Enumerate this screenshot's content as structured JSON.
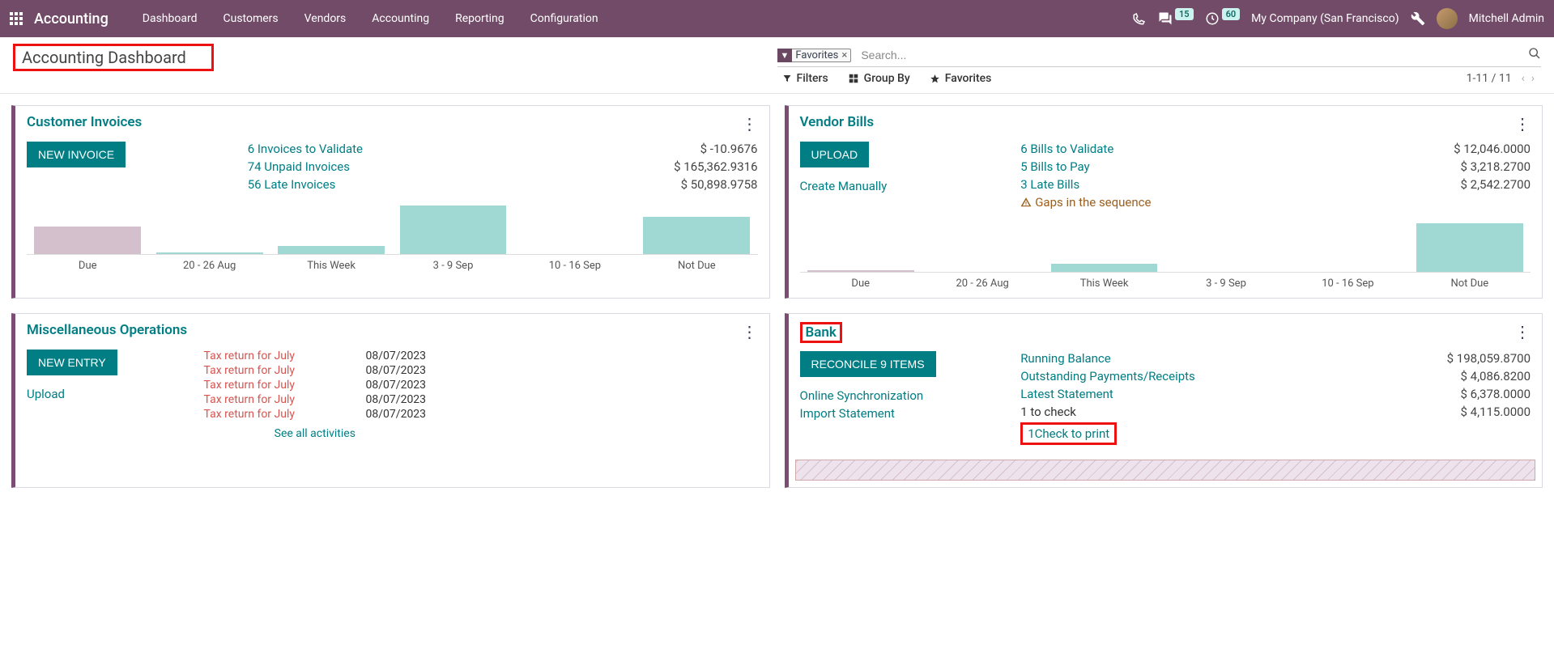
{
  "navbar": {
    "brand": "Accounting",
    "menus": [
      "Dashboard",
      "Customers",
      "Vendors",
      "Accounting",
      "Reporting",
      "Configuration"
    ],
    "msg_count": "15",
    "activity_count": "60",
    "company": "My Company (San Francisco)",
    "username": "Mitchell Admin"
  },
  "breadcrumb": {
    "title": "Accounting Dashboard"
  },
  "search": {
    "active_filter": "Favorites",
    "placeholder": "Search...",
    "tb_filters": "Filters",
    "tb_groupby": "Group By",
    "tb_favorites": "Favorites",
    "pager": "1-11 / 11"
  },
  "chart_data": [
    {
      "type": "bar",
      "title": "Customer Invoices",
      "categories": [
        "Due",
        "20 - 26 Aug",
        "This Week",
        "3 - 9 Sep",
        "10 - 16 Sep",
        "Not Due"
      ],
      "values": [
        -28,
        2,
        8,
        50,
        0,
        38
      ],
      "colors": [
        "neg",
        "pos",
        "pos",
        "pos",
        "pos",
        "pos"
      ]
    },
    {
      "type": "bar",
      "title": "Vendor Bills",
      "categories": [
        "Due",
        "20 - 26 Aug",
        "This Week",
        "3 - 9 Sep",
        "10 - 16 Sep",
        "Not Due"
      ],
      "values": [
        -2,
        0,
        8,
        0,
        0,
        48
      ],
      "colors": [
        "neg",
        "pos",
        "pos",
        "pos",
        "pos",
        "pos"
      ]
    }
  ],
  "cards": {
    "cust_inv": {
      "title": "Customer Invoices",
      "button": "NEW INVOICE",
      "links": [
        "6 Invoices to Validate",
        "74 Unpaid Invoices",
        "56 Late Invoices"
      ],
      "amounts": [
        "$ -10.9676",
        "$ 165,362.9316",
        "$ 50,898.9758"
      ]
    },
    "vendor_bills": {
      "title": "Vendor Bills",
      "button": "UPLOAD",
      "create": "Create Manually",
      "links": [
        "6 Bills to Validate",
        "5 Bills to Pay",
        "3 Late Bills"
      ],
      "amounts": [
        "$ 12,046.0000",
        "$ 3,218.2700",
        "$ 2,542.2700"
      ],
      "warning": "Gaps in the sequence"
    },
    "misc": {
      "title": "Miscellaneous Operations",
      "button": "NEW ENTRY",
      "upload": "Upload",
      "rows": [
        {
          "label": "Tax return for July",
          "date": "08/07/2023"
        },
        {
          "label": "Tax return for July",
          "date": "08/07/2023"
        },
        {
          "label": "Tax return for July",
          "date": "08/07/2023"
        },
        {
          "label": "Tax return for July",
          "date": "08/07/2023"
        },
        {
          "label": "Tax return for July",
          "date": "08/07/2023"
        }
      ],
      "see_all": "See all activities"
    },
    "bank": {
      "title": "Bank",
      "button": "RECONCILE 9 ITEMS",
      "sync": "Online Synchronization",
      "import": "Import Statement",
      "links": [
        "Running Balance",
        "Outstanding Payments/Receipts",
        "Latest Statement",
        "1 to check",
        "1Check to print"
      ],
      "amounts": [
        "$ 198,059.8700",
        "$ 4,086.8200",
        "$ 6,378.0000",
        "$ 4,115.0000"
      ]
    }
  }
}
